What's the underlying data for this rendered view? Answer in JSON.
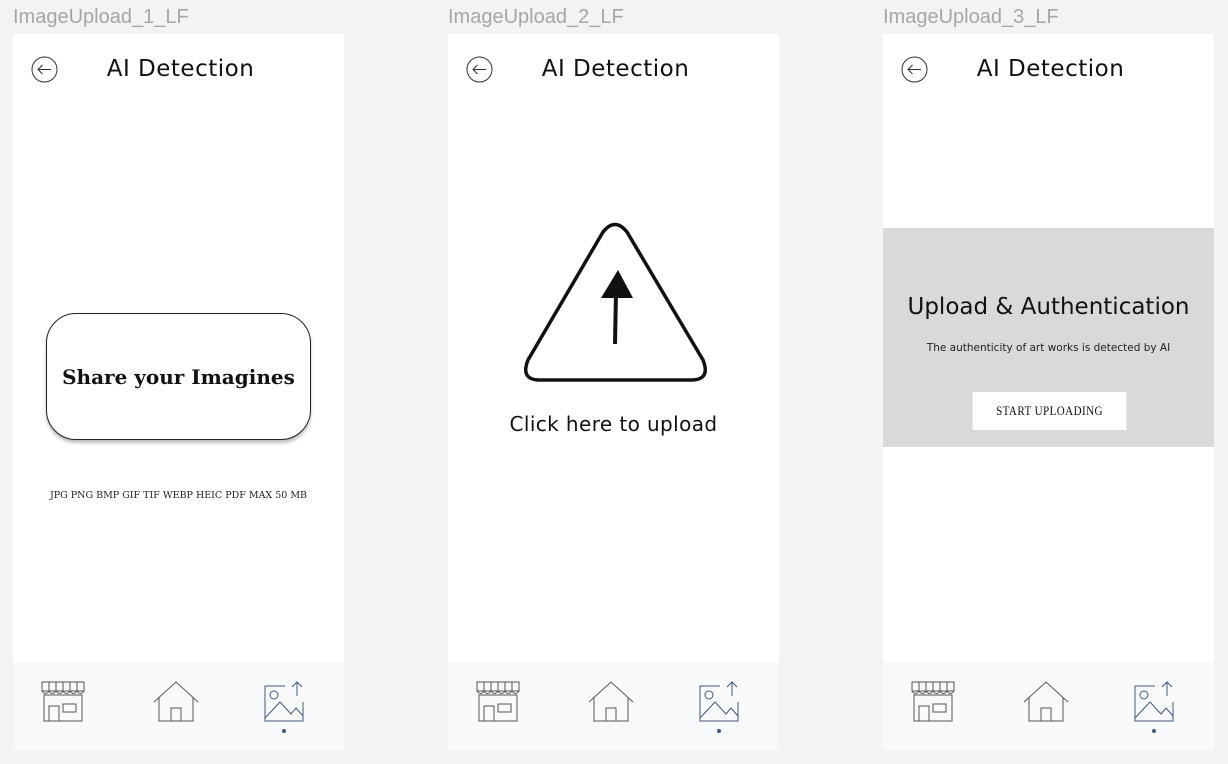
{
  "frames": [
    {
      "label": "ImageUpload_1_LF",
      "title": "AI Detection",
      "card_text": "Share your Imagines",
      "formats_text": "JPG PNG BMP GIF TIF WEBP HEIC PDF  MAX 50 MB"
    },
    {
      "label": "ImageUpload_2_LF",
      "title": "AI Detection",
      "upload_text": "Click here to upload"
    },
    {
      "label": "ImageUpload_3_LF",
      "title": "AI Detection",
      "panel_title": "Upload & Authentication",
      "panel_subtitle": "The authenticity of art works is detected by AI",
      "button_label": "START  UPLOADING"
    }
  ],
  "tabbar": {
    "tabs": [
      {
        "icon": "store-icon"
      },
      {
        "icon": "home-icon"
      },
      {
        "icon": "image-upload-icon",
        "active": true
      }
    ]
  },
  "colors": {
    "canvas": "#f3f3f3",
    "frame": "#ffffff",
    "tabbar": "#f8f9fa",
    "panel": "#d9d9d9",
    "accent": "#44587a",
    "label": "#a6a6a6"
  }
}
